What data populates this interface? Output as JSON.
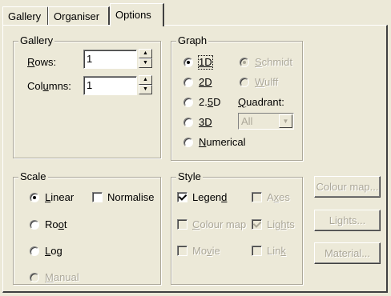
{
  "tabs": [
    "Gallery",
    "Organiser",
    "Options"
  ],
  "gallery": {
    "title": "Gallery",
    "rows_pre": "",
    "rows_u": "R",
    "rows_post": "ows:",
    "rows_value": "1",
    "cols_pre": "Col",
    "cols_u": "u",
    "cols_post": "mns:",
    "cols_value": "1"
  },
  "graph": {
    "title": "Graph",
    "opt_1d": "1D",
    "opt_2d": "2D",
    "opt_25d_pre": "2.",
    "opt_25d_u": "5",
    "opt_25d_post": "D",
    "opt_3d": "3D",
    "opt_num_u": "N",
    "opt_num_post": "umerical",
    "schmidt_u": "S",
    "schmidt_post": "chmidt",
    "wulff_pre": "",
    "wulff_u": "W",
    "wulff_post": "ulff",
    "quadrant_u": "Q",
    "quadrant_post": "uadrant:",
    "quadrant_value": "All",
    "selected": "1D",
    "projection_selected": "Schmidt"
  },
  "scale": {
    "title": "Scale",
    "linear_u": "L",
    "linear_post": "inear",
    "normalise": "Normalise",
    "root_pre": "Ro",
    "root_u": "o",
    "root_post": "t",
    "log_u": "L",
    "log_post": "og",
    "manual_u": "M",
    "manual_post": "anual",
    "selected": "Linear"
  },
  "style": {
    "title": "Style",
    "legend_pre": "Legen",
    "legend_u": "d",
    "legend_post": "",
    "axes_pre": "A",
    "axes_u": "x",
    "axes_post": "es",
    "colourmap_u": "C",
    "colourmap_post": "olour map",
    "lights_pre": "Lig",
    "lights_u": "h",
    "lights_post": "ts",
    "movie_pre": "Mo",
    "movie_u": "v",
    "movie_post": "ie",
    "link_pre": "Lin",
    "link_u": "k",
    "link_post": ""
  },
  "buttons": {
    "colour_map": "Colour map...",
    "lights": "Lights...",
    "material": "Material..."
  },
  "colors": {
    "face": "#ece9d8",
    "disabled_text": "#aca899",
    "shadow": "#404040",
    "highlight": "#ffffff"
  }
}
